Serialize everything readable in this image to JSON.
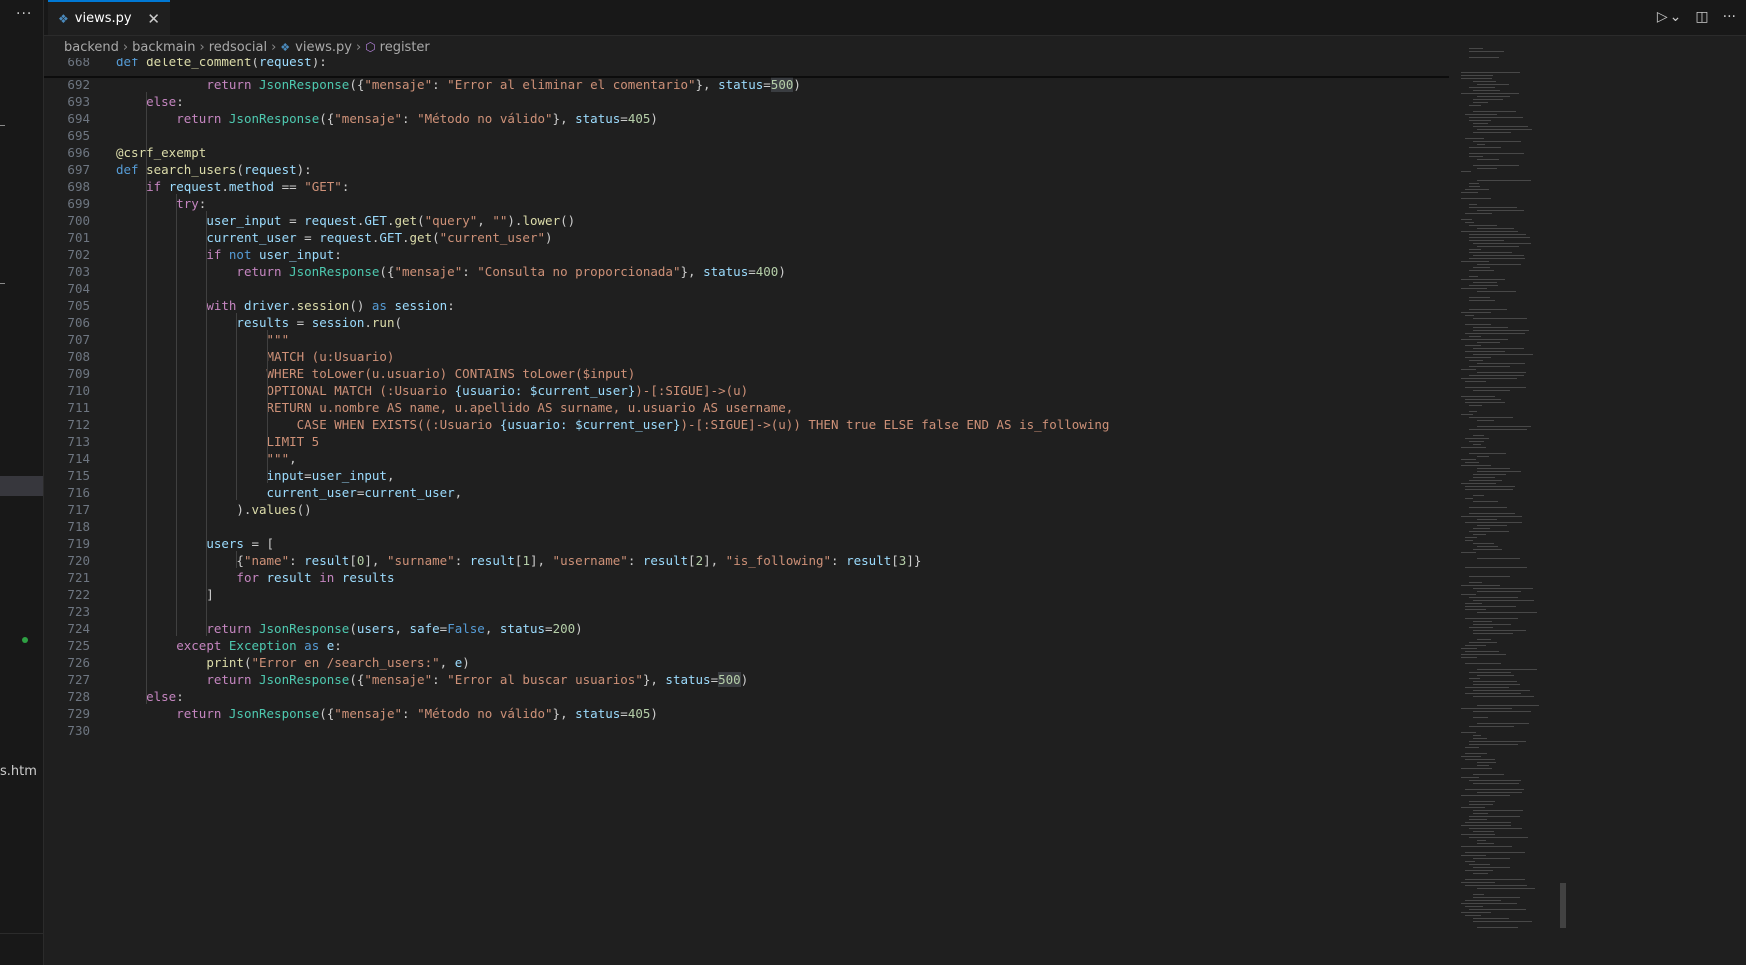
{
  "sidebar": {
    "more_label": "···",
    "partial_file": "s.htm"
  },
  "tab": {
    "icon": "python-file-icon",
    "label": "views.py",
    "close": "✕"
  },
  "actions": {
    "run": "▷",
    "run_menu": "⌄",
    "split": "◫",
    "more": "···"
  },
  "breadcrumb": {
    "items": [
      "backend",
      "backmain",
      "redsocial",
      "views.py",
      "register"
    ]
  },
  "sticky": {
    "ln": "668",
    "code": "def delete_comment(request):"
  },
  "lines": [
    {
      "n": "692",
      "code": "            return JsonResponse({\"mensaje\": \"Error al eliminar el comentario\"}, status=500)"
    },
    {
      "n": "693",
      "code": "    else:"
    },
    {
      "n": "694",
      "code": "        return JsonResponse({\"mensaje\": \"Método no válido\"}, status=405)"
    },
    {
      "n": "695",
      "code": ""
    },
    {
      "n": "696",
      "code": "@csrf_exempt"
    },
    {
      "n": "697",
      "code": "def search_users(request):"
    },
    {
      "n": "698",
      "code": "    if request.method == \"GET\":"
    },
    {
      "n": "699",
      "code": "        try:"
    },
    {
      "n": "700",
      "code": "            user_input = request.GET.get(\"query\", \"\").lower()"
    },
    {
      "n": "701",
      "code": "            current_user = request.GET.get(\"current_user\")"
    },
    {
      "n": "702",
      "code": "            if not user_input:"
    },
    {
      "n": "703",
      "code": "                return JsonResponse({\"mensaje\": \"Consulta no proporcionada\"}, status=400)"
    },
    {
      "n": "704",
      "code": ""
    },
    {
      "n": "705",
      "code": "            with driver.session() as session:"
    },
    {
      "n": "706",
      "code": "                results = session.run("
    },
    {
      "n": "707",
      "code": "                    \"\"\""
    },
    {
      "n": "708",
      "code": "                    MATCH (u:Usuario)"
    },
    {
      "n": "709",
      "code": "                    WHERE toLower(u.usuario) CONTAINS toLower($input)"
    },
    {
      "n": "710",
      "code": "                    OPTIONAL MATCH (:Usuario {usuario: $current_user})-[:SIGUE]->(u)"
    },
    {
      "n": "711",
      "code": "                    RETURN u.nombre AS name, u.apellido AS surname, u.usuario AS username,"
    },
    {
      "n": "712",
      "code": "                        CASE WHEN EXISTS((:Usuario {usuario: $current_user})-[:SIGUE]->(u)) THEN true ELSE false END AS is_following"
    },
    {
      "n": "713",
      "code": "                    LIMIT 5"
    },
    {
      "n": "714",
      "code": "                    \"\"\","
    },
    {
      "n": "715",
      "code": "                    input=user_input,"
    },
    {
      "n": "716",
      "code": "                    current_user=current_user,"
    },
    {
      "n": "717",
      "code": "                ).values()"
    },
    {
      "n": "718",
      "code": ""
    },
    {
      "n": "719",
      "code": "            users = ["
    },
    {
      "n": "720",
      "code": "                {\"name\": result[0], \"surname\": result[1], \"username\": result[2], \"is_following\": result[3]}"
    },
    {
      "n": "721",
      "code": "                for result in results"
    },
    {
      "n": "722",
      "code": "            ]"
    },
    {
      "n": "723",
      "code": ""
    },
    {
      "n": "724",
      "code": "            return JsonResponse(users, safe=False, status=200)"
    },
    {
      "n": "725",
      "code": "        except Exception as e:"
    },
    {
      "n": "726",
      "code": "            print(\"Error en /search_users:\", e)"
    },
    {
      "n": "727",
      "code": "            return JsonResponse({\"mensaje\": \"Error al buscar usuarios\"}, status=500)"
    },
    {
      "n": "728",
      "code": "    else:"
    },
    {
      "n": "729",
      "code": "        return JsonResponse({\"mensaje\": \"Método no válido\"}, status=405)"
    },
    {
      "n": "730",
      "code": ""
    }
  ],
  "colors": {
    "accent": "#0078d4",
    "keyword": "#569cd6",
    "control": "#c586c0",
    "function": "#dcdcaa",
    "class": "#4ec9b0",
    "variable": "#9cdcfe",
    "string": "#ce9178",
    "number": "#b5cea8"
  }
}
